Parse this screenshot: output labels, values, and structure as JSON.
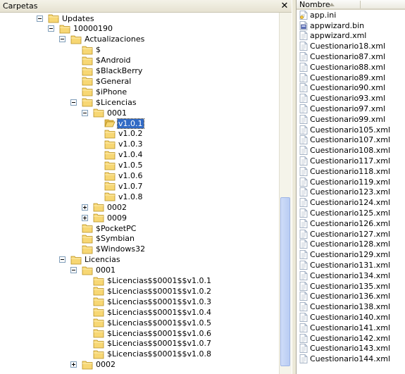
{
  "folders_pane": {
    "title": "Carpetas",
    "close_label": "✕"
  },
  "tree": [
    {
      "label": "Updates",
      "depth": 0,
      "expander": "minus"
    },
    {
      "label": "10000190",
      "depth": 1,
      "expander": "minus"
    },
    {
      "label": "Actualizaciones",
      "depth": 2,
      "expander": "minus"
    },
    {
      "label": "$",
      "depth": 3,
      "expander": "none"
    },
    {
      "label": "$Android",
      "depth": 3,
      "expander": "none"
    },
    {
      "label": "$BlackBerry",
      "depth": 3,
      "expander": "none"
    },
    {
      "label": "$General",
      "depth": 3,
      "expander": "none"
    },
    {
      "label": "$iPhone",
      "depth": 3,
      "expander": "none"
    },
    {
      "label": "$Licencias",
      "depth": 3,
      "expander": "minus"
    },
    {
      "label": "0001",
      "depth": 4,
      "expander": "minus"
    },
    {
      "label": "v1.0.1",
      "depth": 5,
      "expander": "none",
      "selected": true,
      "open": true
    },
    {
      "label": "v1.0.2",
      "depth": 5,
      "expander": "none"
    },
    {
      "label": "v1.0.3",
      "depth": 5,
      "expander": "none"
    },
    {
      "label": "v1.0.4",
      "depth": 5,
      "expander": "none"
    },
    {
      "label": "v1.0.5",
      "depth": 5,
      "expander": "none"
    },
    {
      "label": "v1.0.6",
      "depth": 5,
      "expander": "none"
    },
    {
      "label": "v1.0.7",
      "depth": 5,
      "expander": "none"
    },
    {
      "label": "v1.0.8",
      "depth": 5,
      "expander": "none"
    },
    {
      "label": "0002",
      "depth": 4,
      "expander": "plus"
    },
    {
      "label": "0009",
      "depth": 4,
      "expander": "plus"
    },
    {
      "label": "$PocketPC",
      "depth": 3,
      "expander": "none"
    },
    {
      "label": "$Symbian",
      "depth": 3,
      "expander": "none"
    },
    {
      "label": "$Windows32",
      "depth": 3,
      "expander": "none"
    },
    {
      "label": "Licencias",
      "depth": 2,
      "expander": "minus"
    },
    {
      "label": "0001",
      "depth": 3,
      "expander": "minus"
    },
    {
      "label": "$Licencias$$0001$$v1.0.1",
      "depth": 4,
      "expander": "none"
    },
    {
      "label": "$Licencias$$0001$$v1.0.2",
      "depth": 4,
      "expander": "none"
    },
    {
      "label": "$Licencias$$0001$$v1.0.3",
      "depth": 4,
      "expander": "none"
    },
    {
      "label": "$Licencias$$0001$$v1.0.4",
      "depth": 4,
      "expander": "none"
    },
    {
      "label": "$Licencias$$0001$$v1.0.5",
      "depth": 4,
      "expander": "none"
    },
    {
      "label": "$Licencias$$0001$$v1.0.6",
      "depth": 4,
      "expander": "none"
    },
    {
      "label": "$Licencias$$0001$$v1.0.7",
      "depth": 4,
      "expander": "none"
    },
    {
      "label": "$Licencias$$0001$$v1.0.8",
      "depth": 4,
      "expander": "none"
    },
    {
      "label": "0002",
      "depth": 3,
      "expander": "plus"
    }
  ],
  "files_pane": {
    "column_name": "Nombre"
  },
  "files": [
    {
      "name": "app.ini",
      "icon": "ini-file-icon"
    },
    {
      "name": "appwizard.bin",
      "icon": "bin-file-icon"
    },
    {
      "name": "appwizard.xml",
      "icon": "xml-file-icon"
    },
    {
      "name": "Cuestionario18.xml",
      "icon": "xml-file-icon"
    },
    {
      "name": "Cuestionario87.xml",
      "icon": "xml-file-icon"
    },
    {
      "name": "Cuestionario88.xml",
      "icon": "xml-file-icon"
    },
    {
      "name": "Cuestionario89.xml",
      "icon": "xml-file-icon"
    },
    {
      "name": "Cuestionario90.xml",
      "icon": "xml-file-icon"
    },
    {
      "name": "Cuestionario93.xml",
      "icon": "xml-file-icon"
    },
    {
      "name": "Cuestionario97.xml",
      "icon": "xml-file-icon"
    },
    {
      "name": "Cuestionario99.xml",
      "icon": "xml-file-icon"
    },
    {
      "name": "Cuestionario105.xml",
      "icon": "xml-file-icon"
    },
    {
      "name": "Cuestionario107.xml",
      "icon": "xml-file-icon"
    },
    {
      "name": "Cuestionario108.xml",
      "icon": "xml-file-icon"
    },
    {
      "name": "Cuestionario117.xml",
      "icon": "xml-file-icon"
    },
    {
      "name": "Cuestionario118.xml",
      "icon": "xml-file-icon"
    },
    {
      "name": "Cuestionario119.xml",
      "icon": "xml-file-icon"
    },
    {
      "name": "Cuestionario123.xml",
      "icon": "xml-file-icon"
    },
    {
      "name": "Cuestionario124.xml",
      "icon": "xml-file-icon"
    },
    {
      "name": "Cuestionario125.xml",
      "icon": "xml-file-icon"
    },
    {
      "name": "Cuestionario126.xml",
      "icon": "xml-file-icon"
    },
    {
      "name": "Cuestionario127.xml",
      "icon": "xml-file-icon"
    },
    {
      "name": "Cuestionario128.xml",
      "icon": "xml-file-icon"
    },
    {
      "name": "Cuestionario129.xml",
      "icon": "xml-file-icon"
    },
    {
      "name": "Cuestionario131.xml",
      "icon": "xml-file-icon"
    },
    {
      "name": "Cuestionario134.xml",
      "icon": "xml-file-icon"
    },
    {
      "name": "Cuestionario135.xml",
      "icon": "xml-file-icon"
    },
    {
      "name": "Cuestionario136.xml",
      "icon": "xml-file-icon"
    },
    {
      "name": "Cuestionario138.xml",
      "icon": "xml-file-icon"
    },
    {
      "name": "Cuestionario140.xml",
      "icon": "xml-file-icon"
    },
    {
      "name": "Cuestionario141.xml",
      "icon": "xml-file-icon"
    },
    {
      "name": "Cuestionario142.xml",
      "icon": "xml-file-icon"
    },
    {
      "name": "Cuestionario143.xml",
      "icon": "xml-file-icon"
    },
    {
      "name": "Cuestionario144.xml",
      "icon": "xml-file-icon"
    }
  ],
  "colors": {
    "selection": "#316ac5",
    "folder": "#f7d774",
    "pane_header": "#ece9d8"
  }
}
